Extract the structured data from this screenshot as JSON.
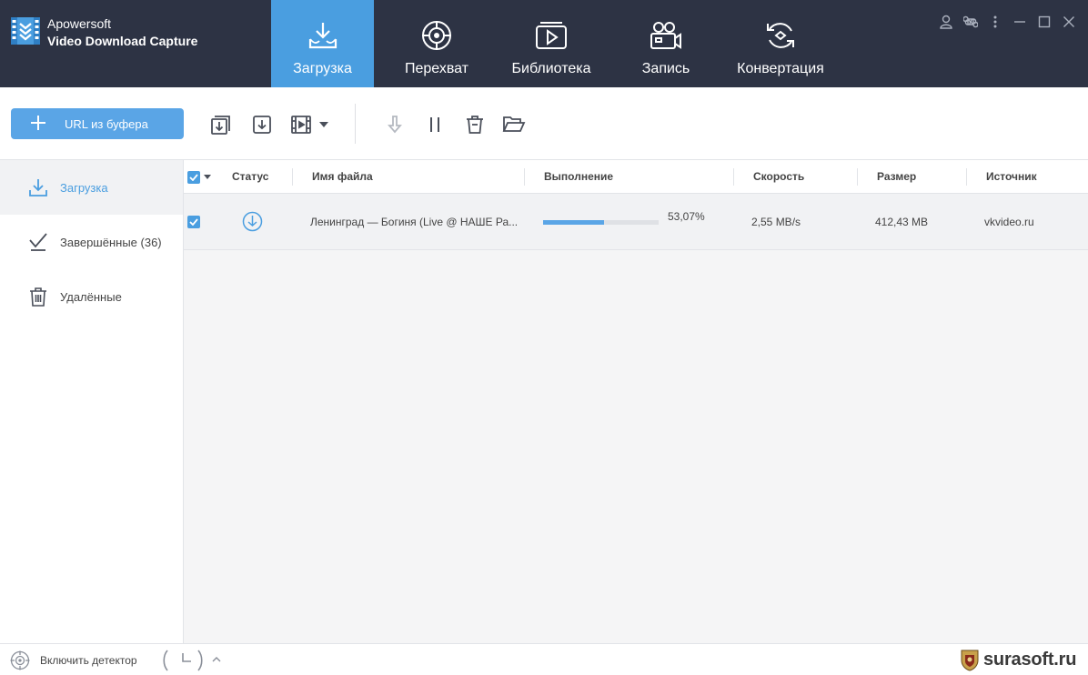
{
  "app": {
    "brand_name": "Apowersoft",
    "product_name": "Video Download Capture",
    "accent_color": "#4a9ee0",
    "header_color": "#2d3344"
  },
  "nav": {
    "tabs": [
      {
        "label": "Загрузка",
        "icon": "download-tray-icon",
        "active": true
      },
      {
        "label": "Перехват",
        "icon": "target-icon",
        "active": false
      },
      {
        "label": "Библиотека",
        "icon": "library-icon",
        "active": false
      },
      {
        "label": "Запись",
        "icon": "camera-icon",
        "active": false
      },
      {
        "label": "Конвертация",
        "icon": "convert-icon",
        "active": false
      }
    ]
  },
  "window_controls": [
    "user-icon",
    "command-icon",
    "more-vertical-icon",
    "minimize-icon",
    "maximize-icon",
    "close-icon"
  ],
  "toolbar": {
    "url_button_label": "URL из буфера",
    "icons": [
      "import-list-icon",
      "download-box-icon",
      "video-add-icon",
      "chevron-down-icon",
      "start-download-icon",
      "pause-icon",
      "delete-icon",
      "open-folder-icon"
    ]
  },
  "sidebar": {
    "items": [
      {
        "label": "Загрузка",
        "icon": "download-icon",
        "active": true
      },
      {
        "label": "Завершённые (36)",
        "icon": "check-icon",
        "active": false
      },
      {
        "label": "Удалённые",
        "icon": "trash-icon",
        "active": false
      }
    ]
  },
  "table": {
    "columns": {
      "status": "Статус",
      "filename": "Имя файла",
      "progress": "Выполнение",
      "speed": "Скорость",
      "size": "Размер",
      "source": "Источник"
    },
    "rows": [
      {
        "checked": true,
        "status_icon": "downloading-icon",
        "filename": "Ленинград — Богиня (Live @ НАШЕ Ра...",
        "progress_text": "53,07%",
        "progress_fraction": 0.5307,
        "speed": "2,55 MB/s",
        "size": "412,43 MB",
        "source": "vkvideo.ru"
      }
    ]
  },
  "footer": {
    "detector_label": "Включить детектор",
    "watermark": "surasoft.ru"
  }
}
